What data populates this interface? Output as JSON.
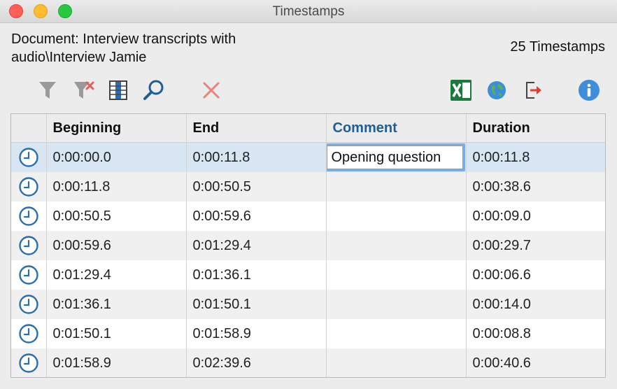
{
  "window": {
    "title": "Timestamps"
  },
  "header": {
    "document_label": "Document: Interview transcripts with audio\\Interview Jamie",
    "timestamp_count": "25 Timestamps"
  },
  "toolbar": {
    "icons": [
      "filter-icon",
      "clear-filter-icon",
      "columns-icon",
      "search-icon",
      "delete-icon",
      "excel-export-icon",
      "web-export-icon",
      "export-icon",
      "info-icon"
    ]
  },
  "table": {
    "columns": [
      "Beginning",
      "End",
      "Comment",
      "Duration"
    ],
    "rows": [
      {
        "beginning": "0:00:00.0",
        "end": "0:00:11.8",
        "comment": "Opening question",
        "duration": "0:00:11.8"
      },
      {
        "beginning": "0:00:11.8",
        "end": "0:00:50.5",
        "comment": "",
        "duration": "0:00:38.6"
      },
      {
        "beginning": "0:00:50.5",
        "end": "0:00:59.6",
        "comment": "",
        "duration": "0:00:09.0"
      },
      {
        "beginning": "0:00:59.6",
        "end": "0:01:29.4",
        "comment": "",
        "duration": "0:00:29.7"
      },
      {
        "beginning": "0:01:29.4",
        "end": "0:01:36.1",
        "comment": "",
        "duration": "0:00:06.6"
      },
      {
        "beginning": "0:01:36.1",
        "end": "0:01:50.1",
        "comment": "",
        "duration": "0:00:14.0"
      },
      {
        "beginning": "0:01:50.1",
        "end": "0:01:58.9",
        "comment": "",
        "duration": "0:00:08.8"
      },
      {
        "beginning": "0:01:58.9",
        "end": "0:02:39.6",
        "comment": "",
        "duration": "0:00:40.6"
      }
    ]
  },
  "colors": {
    "accent": "#1f5d96",
    "selection": "#d8e6f3",
    "clock_icon": "#2a6fad"
  }
}
